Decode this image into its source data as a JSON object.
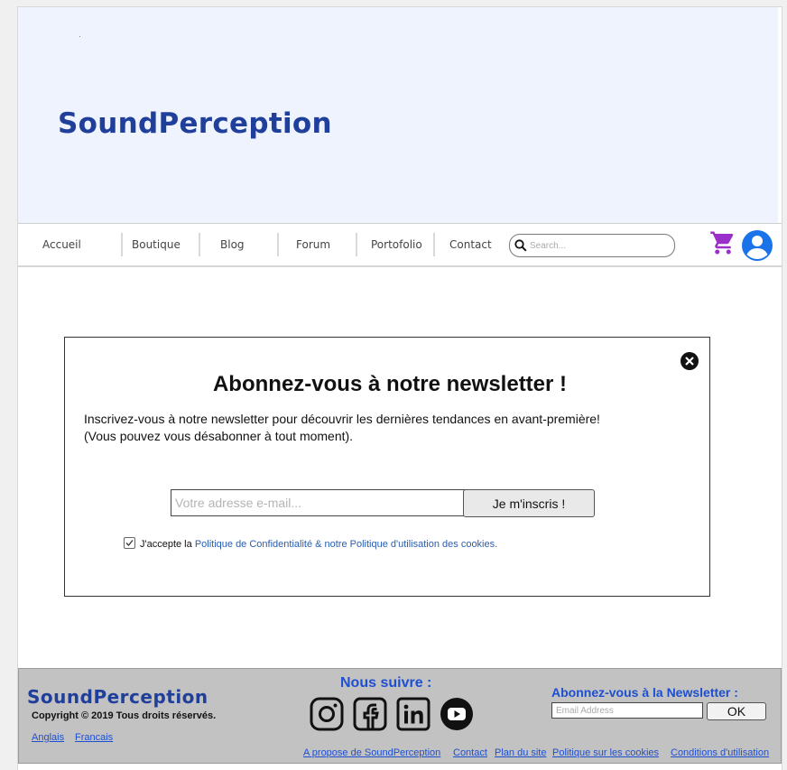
{
  "header": {
    "brand": "SoundPerception"
  },
  "nav": {
    "items": [
      {
        "label": "Accueil"
      },
      {
        "label": "Boutique"
      },
      {
        "label": "Blog"
      },
      {
        "label": "Forum"
      },
      {
        "label": "Portofolio"
      },
      {
        "label": "Contact"
      }
    ],
    "search_placeholder": "Search...",
    "cart_icon": "shopping-cart-icon",
    "account_icon": "account-circle-icon"
  },
  "modal": {
    "title": "Abonnez-vous à notre newsletter !",
    "description_line1": "Inscrivez-vous à notre newsletter pour découvrir les dernières tendances en avant-première!",
    "description_line2": "(Vous pouvez vous désabonner à tout moment).",
    "email_placeholder": "Votre adresse e-mail...",
    "submit_label": "Je m'inscris !",
    "consent_prefix": "J'accepte la ",
    "consent_link": "Politique de Confidentialité & notre Politique d'utilisation des cookies.",
    "consent_checked": true
  },
  "footer": {
    "brand": "SoundPerception",
    "copyright": "Copyright © 2019 Tous droits réservés.",
    "languages": [
      "Anglais",
      "Francais"
    ],
    "follow_title": "Nous suivre :",
    "social": [
      "instagram-icon",
      "facebook-icon",
      "linkedin-icon",
      "youtube-icon"
    ],
    "newsletter_title": "Abonnez-vous à la Newsletter :",
    "email_placeholder": "Email Address",
    "ok_label": "OK",
    "links": [
      "A propose de SoundPerception",
      "Contact",
      "Plan du site",
      "Politique sur les cookies",
      "Conditions d'utilisation"
    ]
  },
  "colors": {
    "brand": "#1f3f9a",
    "hero_bg": "#eef3fd",
    "cart": "#9b2fc9",
    "account": "#1a73e8",
    "footer_bg": "#c2c2c2",
    "link": "#1d4fd1"
  }
}
